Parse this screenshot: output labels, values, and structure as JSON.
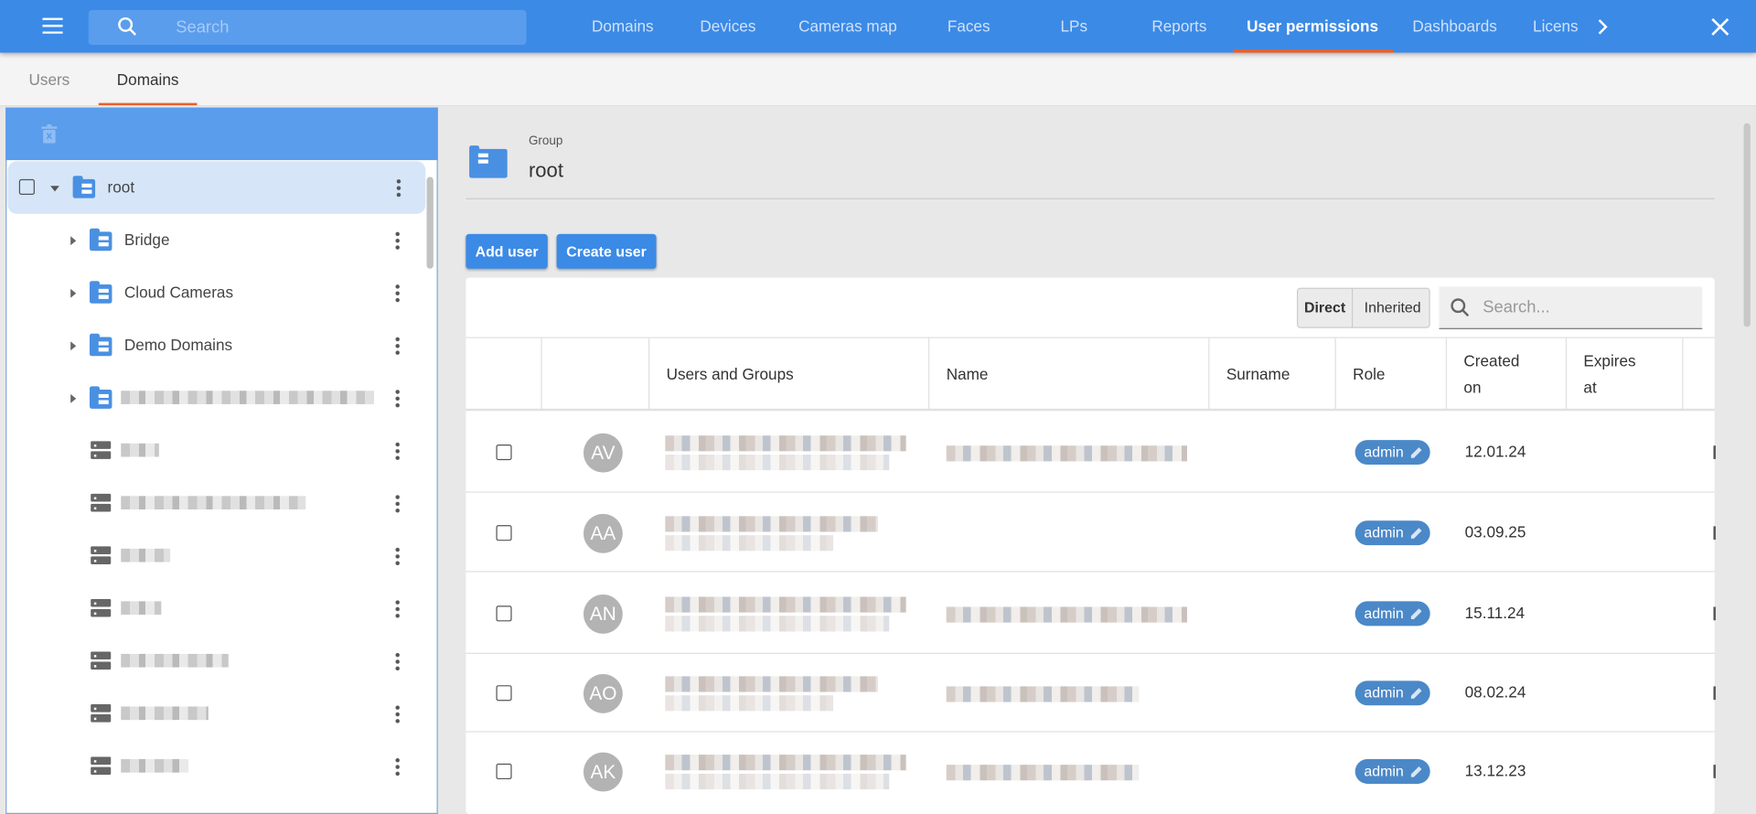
{
  "topbar": {
    "search_placeholder": "Search",
    "nav": [
      "Domains",
      "Devices",
      "Cameras map",
      "Faces",
      "LPs",
      "Reports",
      "User permissions",
      "Dashboards",
      "Licens"
    ],
    "active": "User permissions"
  },
  "subtabs": [
    "Users",
    "Domains"
  ],
  "tree": {
    "root": "root",
    "children": [
      "Bridge",
      "Cloud Cameras",
      "Demo Domains"
    ]
  },
  "group": {
    "label": "Group",
    "name": "root"
  },
  "buttons": {
    "add_user": "Add user",
    "create_user": "Create user"
  },
  "filter": {
    "direct": "Direct",
    "inherited": "Inherited",
    "search_placeholder": "Search..."
  },
  "table": {
    "headers": [
      "Users and Groups",
      "Name",
      "Surname",
      "Role",
      "Created on",
      "Expires at"
    ],
    "rows": [
      {
        "initials": "AV",
        "role": "admin",
        "created": "12.01.24"
      },
      {
        "initials": "AA",
        "role": "admin",
        "created": "03.09.25"
      },
      {
        "initials": "AN",
        "role": "admin",
        "created": "15.11.24"
      },
      {
        "initials": "AO",
        "role": "admin",
        "created": "08.02.24"
      },
      {
        "initials": "AK",
        "role": "admin",
        "created": "13.12.23"
      }
    ]
  },
  "colors": {
    "primary": "#3b8ae6",
    "accent": "#e5602d",
    "role_badge": "#4b88c8"
  }
}
